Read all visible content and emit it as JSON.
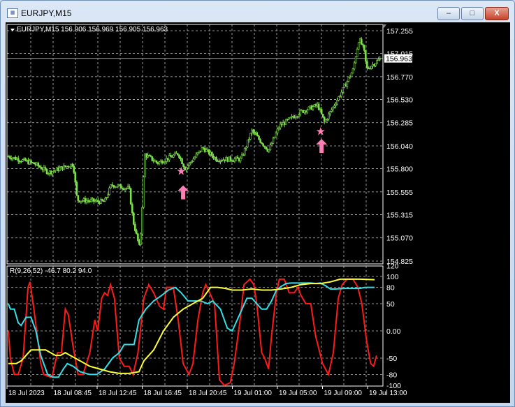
{
  "window": {
    "title": "EURJPY,M15",
    "minimize_label": "–",
    "maximize_label": "□",
    "close_label": "X"
  },
  "chart": {
    "header": "EURJPY,M15  156.906 156.969 156.905 156.963",
    "current_price": "156.963",
    "price_axis": [
      "157.255",
      "157.015",
      "156.770",
      "156.530",
      "156.285",
      "156.040",
      "155.800",
      "155.555",
      "155.315",
      "155.070",
      "154.825"
    ],
    "price_range": [
      154.825,
      157.255
    ],
    "candle_color": "#7ee04a",
    "price_path": [
      [
        0,
        155.93
      ],
      [
        27,
        155.85
      ],
      [
        41,
        155.76
      ],
      [
        66,
        155.85
      ],
      [
        70,
        155.47
      ],
      [
        98,
        155.45
      ],
      [
        105,
        155.63
      ],
      [
        123,
        155.59
      ],
      [
        127,
        155.25
      ],
      [
        134,
        154.95
      ],
      [
        139,
        155.95
      ],
      [
        152,
        155.86
      ],
      [
        173,
        155.96
      ],
      [
        180,
        155.8
      ],
      [
        198,
        156.02
      ],
      [
        212,
        155.9
      ],
      [
        237,
        155.9
      ],
      [
        248,
        156.2
      ],
      [
        265,
        155.99
      ],
      [
        276,
        156.25
      ],
      [
        298,
        156.4
      ],
      [
        315,
        156.47
      ],
      [
        322,
        156.29
      ],
      [
        340,
        156.62
      ],
      [
        351,
        156.84
      ],
      [
        357,
        157.17
      ],
      [
        362,
        157.06
      ],
      [
        365,
        156.85
      ],
      [
        379,
        156.96
      ]
    ],
    "signals": [
      {
        "type": "star",
        "bar": 176,
        "price": 155.77
      },
      {
        "type": "buy-arrow",
        "bar": 178,
        "price": 155.55
      },
      {
        "type": "star",
        "bar": 318,
        "price": 156.19
      },
      {
        "type": "buy-arrow",
        "bar": 319,
        "price": 156.04
      }
    ],
    "signal_color": "#ff7fb5"
  },
  "indicator": {
    "header": "R(9,26,52) -46.7 80.2 94.0",
    "axis": [
      "120",
      "100",
      "80",
      "50",
      "0.00",
      "-50",
      "-80",
      "-100"
    ],
    "axis_values": [
      120,
      100,
      80,
      50,
      0,
      -50,
      -80,
      -100
    ],
    "grid_values": [
      100,
      80,
      50,
      0,
      -50,
      -80
    ],
    "range": [
      -100,
      120
    ],
    "series": [
      {
        "name": "fast",
        "color": "#ff1a1a",
        "points": [
          [
            0,
            0
          ],
          [
            2,
            -50
          ],
          [
            6,
            -80
          ],
          [
            10,
            -80
          ],
          [
            15,
            -50
          ],
          [
            20,
            80
          ],
          [
            22,
            90
          ],
          [
            26,
            40
          ],
          [
            33,
            -60
          ],
          [
            36,
            -80
          ],
          [
            43,
            -85
          ],
          [
            45,
            -80
          ],
          [
            50,
            -40
          ],
          [
            54,
            -40
          ],
          [
            58,
            40
          ],
          [
            61,
            30
          ],
          [
            66,
            -30
          ],
          [
            71,
            -80
          ],
          [
            76,
            -80
          ],
          [
            83,
            -40
          ],
          [
            88,
            20
          ],
          [
            91,
            0
          ],
          [
            95,
            60
          ],
          [
            98,
            70
          ],
          [
            101,
            65
          ],
          [
            104,
            85
          ],
          [
            108,
            60
          ],
          [
            113,
            -50
          ],
          [
            118,
            -65
          ],
          [
            123,
            -65
          ],
          [
            127,
            -80
          ],
          [
            132,
            -40
          ],
          [
            138,
            60
          ],
          [
            143,
            85
          ],
          [
            148,
            70
          ],
          [
            154,
            45
          ],
          [
            158,
            40
          ],
          [
            161,
            80
          ],
          [
            168,
            80
          ],
          [
            173,
            20
          ],
          [
            178,
            -60
          ],
          [
            184,
            -80
          ],
          [
            188,
            -60
          ],
          [
            193,
            20
          ],
          [
            198,
            70
          ],
          [
            201,
            85
          ],
          [
            205,
            70
          ],
          [
            210,
            50
          ],
          [
            215,
            -90
          ],
          [
            220,
            -100
          ],
          [
            226,
            -95
          ],
          [
            230,
            -60
          ],
          [
            236,
            20
          ],
          [
            240,
            85
          ],
          [
            246,
            95
          ],
          [
            250,
            85
          ],
          [
            253,
            50
          ],
          [
            258,
            -40
          ],
          [
            261,
            -50
          ],
          [
            265,
            -70
          ],
          [
            268,
            -10
          ],
          [
            273,
            70
          ],
          [
            276,
            95
          ],
          [
            281,
            95
          ],
          [
            286,
            70
          ],
          [
            291,
            70
          ],
          [
            295,
            80
          ],
          [
            298,
            65
          ],
          [
            303,
            50
          ],
          [
            308,
            50
          ],
          [
            313,
            -10
          ],
          [
            320,
            -60
          ],
          [
            326,
            -80
          ],
          [
            331,
            -40
          ],
          [
            336,
            60
          ],
          [
            340,
            85
          ],
          [
            345,
            95
          ],
          [
            351,
            95
          ],
          [
            356,
            80
          ],
          [
            360,
            50
          ],
          [
            365,
            -20
          ],
          [
            369,
            -60
          ],
          [
            372,
            -65
          ],
          [
            375,
            -45
          ]
        ]
      },
      {
        "name": "medium",
        "color": "#33e0e8",
        "points": [
          [
            0,
            50
          ],
          [
            2,
            40
          ],
          [
            6,
            40
          ],
          [
            10,
            15
          ],
          [
            13,
            10
          ],
          [
            18,
            25
          ],
          [
            23,
            25
          ],
          [
            28,
            0
          ],
          [
            33,
            -45
          ],
          [
            40,
            -80
          ],
          [
            45,
            -85
          ],
          [
            51,
            -85
          ],
          [
            56,
            -70
          ],
          [
            60,
            -60
          ],
          [
            66,
            -65
          ],
          [
            73,
            -75
          ],
          [
            83,
            -80
          ],
          [
            90,
            -80
          ],
          [
            98,
            -70
          ],
          [
            106,
            -50
          ],
          [
            113,
            -40
          ],
          [
            118,
            -25
          ],
          [
            128,
            -25
          ],
          [
            133,
            20
          ],
          [
            140,
            40
          ],
          [
            148,
            55
          ],
          [
            156,
            65
          ],
          [
            163,
            75
          ],
          [
            170,
            80
          ],
          [
            176,
            70
          ],
          [
            183,
            55
          ],
          [
            188,
            55
          ],
          [
            196,
            55
          ],
          [
            203,
            50
          ],
          [
            208,
            55
          ],
          [
            216,
            40
          ],
          [
            223,
            5
          ],
          [
            228,
            0
          ],
          [
            233,
            20
          ],
          [
            238,
            40
          ],
          [
            243,
            60
          ],
          [
            248,
            60
          ],
          [
            253,
            50
          ],
          [
            258,
            40
          ],
          [
            263,
            40
          ],
          [
            268,
            55
          ],
          [
            273,
            75
          ],
          [
            278,
            82
          ],
          [
            283,
            87
          ],
          [
            288,
            88
          ],
          [
            298,
            88
          ],
          [
            308,
            88
          ],
          [
            313,
            87
          ],
          [
            318,
            88
          ],
          [
            323,
            83
          ],
          [
            328,
            77
          ],
          [
            333,
            77
          ],
          [
            343,
            78
          ],
          [
            358,
            78
          ],
          [
            363,
            80
          ],
          [
            373,
            80
          ]
        ]
      },
      {
        "name": "slow",
        "color": "#ffff33",
        "points": [
          [
            0,
            -60
          ],
          [
            8,
            -60
          ],
          [
            13,
            -55
          ],
          [
            18,
            -45
          ],
          [
            23,
            -35
          ],
          [
            28,
            -35
          ],
          [
            38,
            -35
          ],
          [
            43,
            -40
          ],
          [
            48,
            -45
          ],
          [
            53,
            -45
          ],
          [
            58,
            -40
          ],
          [
            63,
            -45
          ],
          [
            68,
            -50
          ],
          [
            73,
            -55
          ],
          [
            83,
            -65
          ],
          [
            93,
            -70
          ],
          [
            103,
            -75
          ],
          [
            113,
            -78
          ],
          [
            123,
            -78
          ],
          [
            133,
            -75
          ],
          [
            138,
            -55
          ],
          [
            148,
            -35
          ],
          [
            158,
            0
          ],
          [
            168,
            25
          ],
          [
            178,
            40
          ],
          [
            188,
            50
          ],
          [
            198,
            60
          ],
          [
            206,
            80
          ],
          [
            213,
            80
          ],
          [
            221,
            78
          ],
          [
            228,
            75
          ],
          [
            238,
            75
          ],
          [
            248,
            77
          ],
          [
            258,
            75
          ],
          [
            268,
            75
          ],
          [
            278,
            77
          ],
          [
            288,
            80
          ],
          [
            298,
            85
          ],
          [
            308,
            87
          ],
          [
            318,
            87
          ],
          [
            328,
            90
          ],
          [
            338,
            95
          ],
          [
            348,
            95
          ],
          [
            358,
            95
          ],
          [
            373,
            94
          ]
        ]
      }
    ]
  },
  "time_axis": [
    "18 Jul 2023",
    "18 Jul 08:45",
    "18 Jul 12:45",
    "18 Jul 16:45",
    "18 Jul 20:45",
    "19 Jul 01:00",
    "19 Jul 05:00",
    "19 Jul 09:00",
    "19 Jul 13:00"
  ],
  "colors": {
    "background": "#000000",
    "grid": "#c0c0c0",
    "axis_text": "#ffffff"
  }
}
